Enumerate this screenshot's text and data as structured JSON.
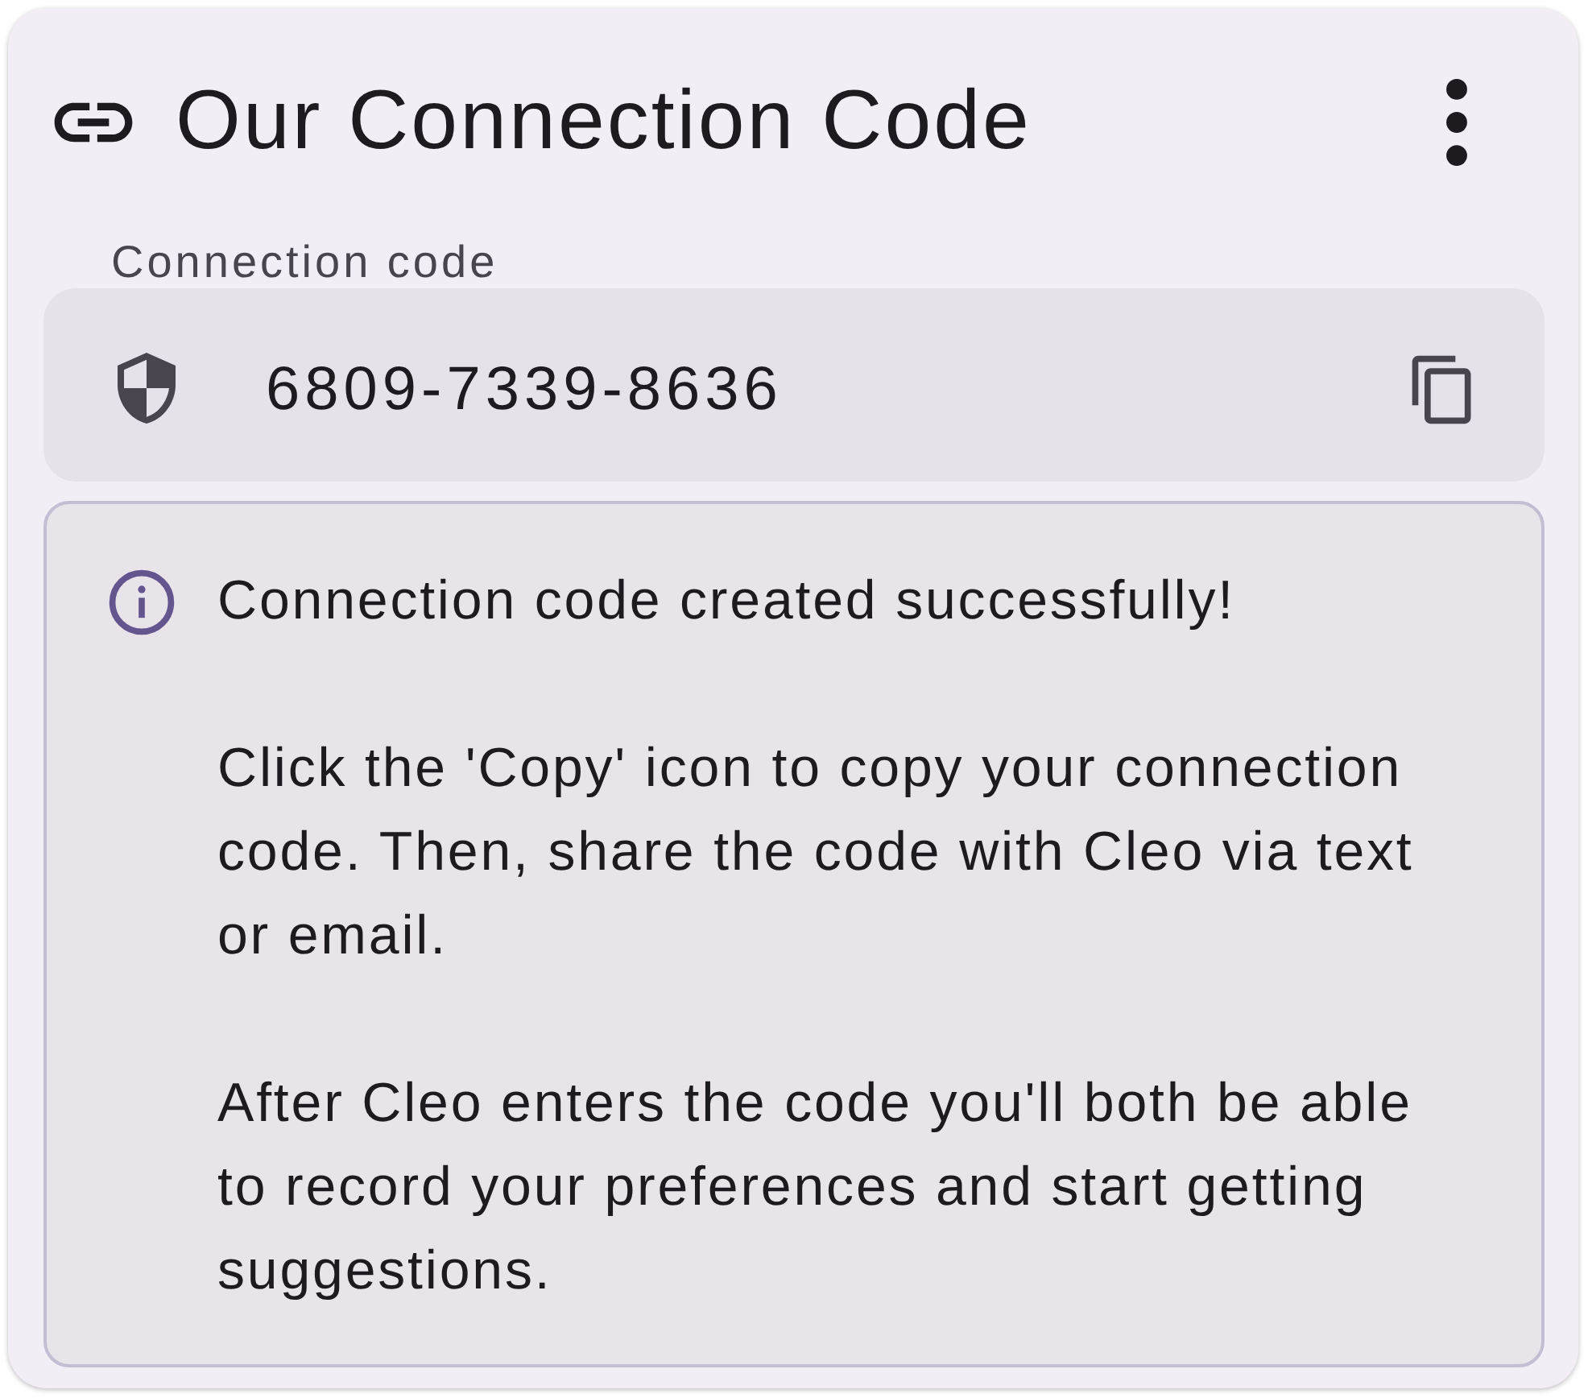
{
  "card": {
    "title": "Our Connection Code"
  },
  "code_field": {
    "label": "Connection code",
    "value": "6809-7339-8636"
  },
  "info": {
    "paragraphs": [
      "Connection code created successfully!",
      "Click the 'Copy' icon to copy your connection code. Then, share the code with Cleo via text or email.",
      "After Cleo enters the code you'll both be able to record your preferences and start getting suggestions."
    ]
  }
}
